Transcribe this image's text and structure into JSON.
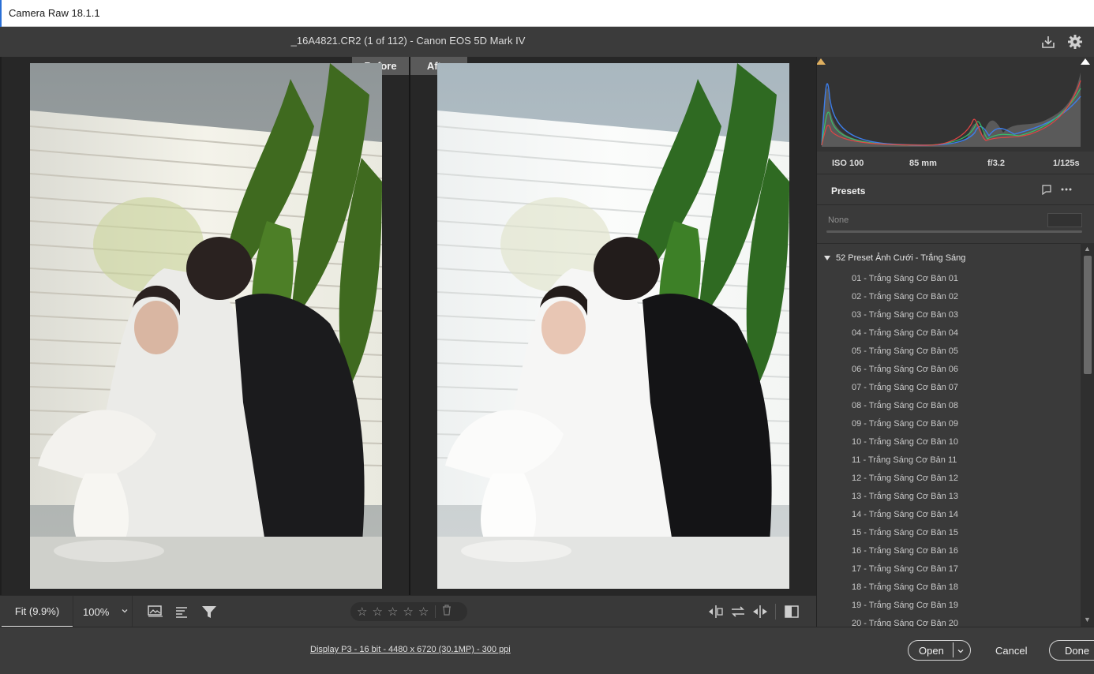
{
  "window": {
    "title": "Camera Raw 18.1.1"
  },
  "header": {
    "filename": "_16A4821.CR2 (1 of 112)  -  Canon EOS 5D Mark IV",
    "save_icon": "download-icon",
    "settings_icon": "gear-icon"
  },
  "viewer": {
    "before_label": "Before",
    "after_label": "After"
  },
  "viewtools": {
    "fit_label": "Fit (9.9%)",
    "zoom_label": "100%",
    "stars": [
      "☆",
      "☆",
      "☆",
      "☆",
      "☆"
    ],
    "rating_value": 0
  },
  "exif": {
    "iso": "ISO 100",
    "focal": "85 mm",
    "aperture": "f/3.2",
    "shutter": "1/125s"
  },
  "presets": {
    "title": "Presets",
    "amount_label": "None",
    "group_name": "52 Preset Ảnh Cưới - Trắng Sáng",
    "items": [
      "01 - Trắng Sáng Cơ Bản 01",
      "02 - Trắng Sáng Cơ Bản 02",
      "03 - Trắng Sáng Cơ Bản 03",
      "04 - Trắng Sáng Cơ Bản 04",
      "05 - Trắng Sáng Cơ Bản 05",
      "06 - Trắng Sáng Cơ Bản 06",
      "07 - Trắng Sáng Cơ Bản 07",
      "08 - Trắng Sáng Cơ Bản 08",
      "09 - Trắng Sáng Cơ Bản 09",
      "10 - Trắng Sáng Cơ Bản 10",
      "11 - Trắng Sáng Cơ Bản 11",
      "12 - Trắng Sáng Cơ Bản 12",
      "13 - Trắng Sáng Cơ Bản 13",
      "14 - Trắng Sáng Cơ Bản 14",
      "15 - Trắng Sáng Cơ Bản 15",
      "16 - Trắng Sáng Cơ Bản 16",
      "17 - Trắng Sáng Cơ Bản 17",
      "18 - Trắng Sáng Cơ Bản 18",
      "19 - Trắng Sáng Cơ Bản 19",
      "20 - Trắng Sáng Cơ Bản 20"
    ]
  },
  "footer": {
    "info": "Display P3 - 16 bit - 4480 x 6720 (30.1MP) - 300 ppi",
    "open_label": "Open",
    "cancel_label": "Cancel",
    "done_label": "Done"
  }
}
